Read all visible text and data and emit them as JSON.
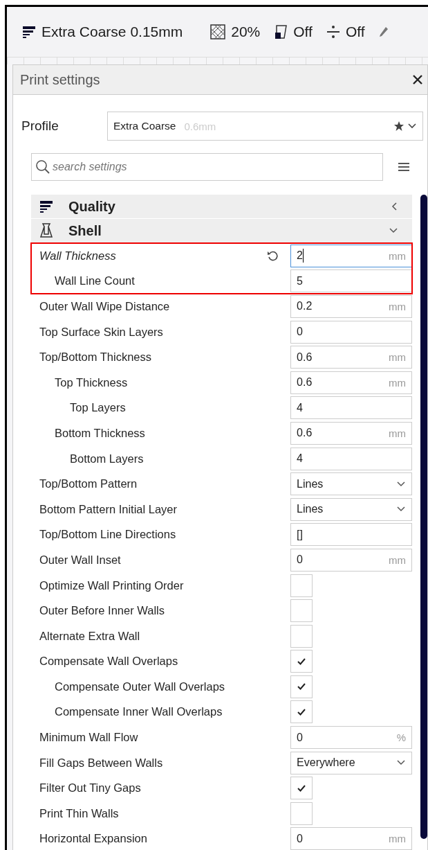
{
  "topbar": {
    "profile": "Extra Coarse 0.15mm",
    "infill": "20%",
    "support": "Off",
    "adhesion": "Off"
  },
  "panel": {
    "title": "Print settings",
    "profile_label": "Profile",
    "profile_name": "Extra Coarse",
    "profile_variant": "0.6mm",
    "search": {
      "placeholder": "search settings"
    }
  },
  "categories": [
    {
      "label": "Quality",
      "expanded": false
    },
    {
      "label": "Shell",
      "expanded": true
    }
  ],
  "settings": [
    {
      "label": "Wall Thickness",
      "kind": "number",
      "value": "2",
      "unit": "mm",
      "modified": true,
      "focused": true,
      "highlighted": true,
      "children": [
        {
          "label": "Wall Line Count",
          "kind": "number",
          "value": "5",
          "modified": false
        }
      ]
    },
    {
      "label": "Outer Wall Wipe Distance",
      "kind": "number",
      "value": "0.2",
      "unit": "mm",
      "modified": false,
      "highlighted": false
    },
    {
      "label": "Top Surface Skin Layers",
      "kind": "number",
      "value": "0",
      "modified": false,
      "highlighted": false
    },
    {
      "label": "Top/Bottom Thickness",
      "kind": "number",
      "value": "0.6",
      "unit": "mm",
      "modified": false,
      "highlighted": false,
      "children": [
        {
          "label": "Top Thickness",
          "kind": "number",
          "value": "0.6",
          "unit": "mm",
          "modified": false,
          "children": [
            {
              "label": "Top Layers",
              "kind": "number",
              "value": "4",
              "modified": false
            }
          ]
        },
        {
          "label": "Bottom Thickness",
          "kind": "number",
          "value": "0.6",
          "unit": "mm",
          "modified": false,
          "children": [
            {
              "label": "Bottom Layers",
              "kind": "number",
              "value": "4",
              "modified": false
            }
          ]
        }
      ]
    },
    {
      "label": "Top/Bottom Pattern",
      "kind": "dropdown",
      "value": "Lines",
      "modified": false,
      "highlighted": false
    },
    {
      "label": "Bottom Pattern Initial Layer",
      "kind": "dropdown",
      "value": "Lines",
      "modified": false,
      "highlighted": false
    },
    {
      "label": "Top/Bottom Line Directions",
      "kind": "number",
      "value": "[]",
      "modified": false,
      "highlighted": false
    },
    {
      "label": "Outer Wall Inset",
      "kind": "number",
      "value": "0",
      "unit": "mm",
      "modified": false,
      "highlighted": false
    },
    {
      "label": "Optimize Wall Printing Order",
      "kind": "checkbox",
      "checked": false,
      "modified": false,
      "highlighted": false
    },
    {
      "label": "Outer Before Inner Walls",
      "kind": "checkbox",
      "checked": false,
      "modified": false,
      "highlighted": false
    },
    {
      "label": "Alternate Extra Wall",
      "kind": "checkbox",
      "checked": false,
      "modified": false,
      "highlighted": false
    },
    {
      "label": "Compensate Wall Overlaps",
      "kind": "checkbox",
      "checked": true,
      "modified": false,
      "highlighted": false,
      "children": [
        {
          "label": "Compensate Outer Wall Overlaps",
          "kind": "checkbox",
          "checked": true,
          "modified": false
        },
        {
          "label": "Compensate Inner Wall Overlaps",
          "kind": "checkbox",
          "checked": true,
          "modified": false
        }
      ]
    },
    {
      "label": "Minimum Wall Flow",
      "kind": "number",
      "value": "0",
      "unit": "%",
      "modified": false,
      "highlighted": false
    },
    {
      "label": "Fill Gaps Between Walls",
      "kind": "dropdown",
      "value": "Everywhere",
      "modified": false,
      "highlighted": false
    },
    {
      "label": "Filter Out Tiny Gaps",
      "kind": "checkbox",
      "checked": true,
      "modified": false,
      "highlighted": false
    },
    {
      "label": "Print Thin Walls",
      "kind": "checkbox",
      "checked": false,
      "modified": false,
      "highlighted": false
    },
    {
      "label": "Horizontal Expansion",
      "kind": "number",
      "value": "0",
      "unit": "mm",
      "modified": false,
      "highlighted": false
    }
  ]
}
